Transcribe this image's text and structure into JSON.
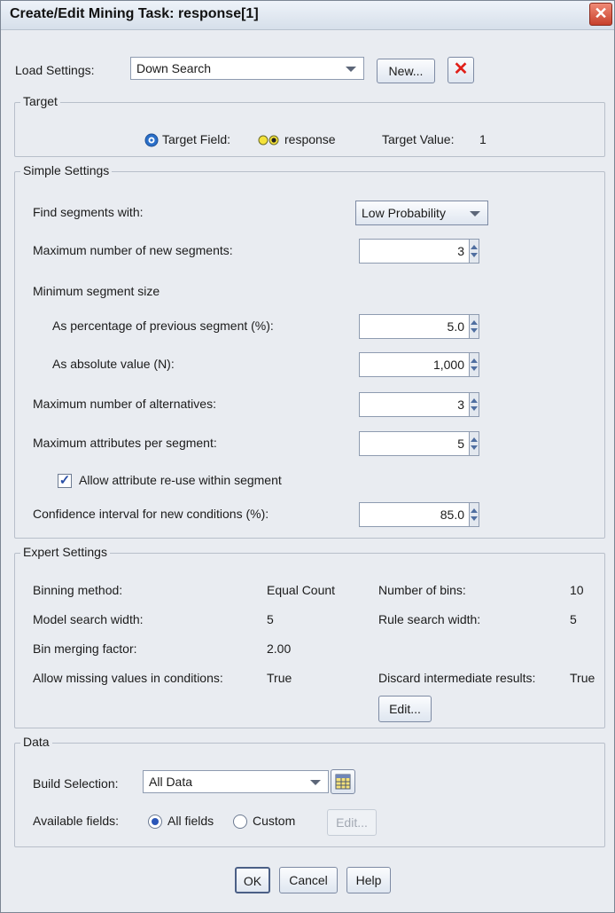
{
  "window": {
    "title": "Create/Edit Mining Task: response[1]",
    "close_glyph": "✕"
  },
  "load_settings": {
    "label": "Load Settings:",
    "value": "Down Search",
    "new_button": "New...",
    "delete_glyph": "✕"
  },
  "target": {
    "group_title": "Target",
    "field_label": "Target Field:",
    "field_value": "response",
    "value_label": "Target Value:",
    "value": "1"
  },
  "simple": {
    "group_title": "Simple Settings",
    "find_segments_label": "Find segments with:",
    "find_segments_value": "Low Probability",
    "max_new_segments_label": "Maximum number of new segments:",
    "max_new_segments": "3",
    "min_segment_size_label": "Minimum segment size",
    "pct_prev_label": "As percentage of previous segment (%):",
    "pct_prev": "5.0",
    "abs_value_label": "As absolute value (N):",
    "abs_value": "1,000",
    "max_alternatives_label": "Maximum number of alternatives:",
    "max_alternatives": "3",
    "max_attributes_label": "Maximum attributes per segment:",
    "max_attributes": "5",
    "allow_reuse_label": "Allow attribute re-use within segment",
    "allow_reuse_checked": true,
    "confidence_label": "Confidence interval for new conditions (%):",
    "confidence": "85.0"
  },
  "expert": {
    "group_title": "Expert Settings",
    "binning_label": "Binning method:",
    "binning_value": "Equal Count",
    "num_bins_label": "Number of bins:",
    "num_bins_value": "10",
    "model_width_label": "Model search width:",
    "model_width_value": "5",
    "rule_width_label": "Rule search width:",
    "rule_width_value": "5",
    "bin_merge_label": "Bin merging factor:",
    "bin_merge_value": "2.00",
    "missing_label": "Allow missing values in conditions:",
    "missing_value": "True",
    "discard_label": "Discard intermediate results:",
    "discard_value": "True",
    "edit_button": "Edit..."
  },
  "data": {
    "group_title": "Data",
    "build_label": "Build Selection:",
    "build_value": "All Data",
    "available_label": "Available fields:",
    "all_fields_label": "All fields",
    "custom_label": "Custom",
    "selected": "All fields",
    "edit_button": "Edit..."
  },
  "footer": {
    "ok": "OK",
    "cancel": "Cancel",
    "help": "Help"
  }
}
